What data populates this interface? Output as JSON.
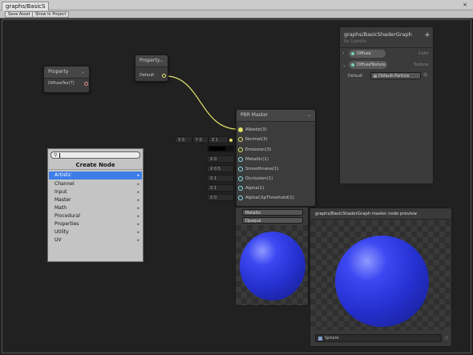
{
  "window": {
    "tab_title": "graphs/BasicS",
    "close_glyph": "×"
  },
  "toolbar": {
    "save_asset": "Save Asset",
    "show_in_project": "Show In Project"
  },
  "properties_node": {
    "title": "Property",
    "chevron": "⌄",
    "output_label": "DiffuseTex(T)"
  },
  "property_node": {
    "title": "Property",
    "chevron": "⌄",
    "output_label": "Default"
  },
  "master_node": {
    "title": "PBR Master",
    "chevron": "⌄",
    "slots": [
      {
        "label": "Albedo(3)",
        "port_color": "#e0e06a"
      },
      {
        "label": "Normal(3)",
        "port_color": "#e0e06a"
      },
      {
        "label": "Emission(3)",
        "port_color": "#e0e06a"
      },
      {
        "label": "Metallic(1)",
        "port_color": "#84e4e7"
      },
      {
        "label": "Smoothness(1)",
        "port_color": "#84e4e7"
      },
      {
        "label": "Occlusion(1)",
        "port_color": "#84e4e7"
      },
      {
        "label": "Alpha(1)",
        "port_color": "#84e4e7"
      },
      {
        "label": "AlphaClipThreshold(1)",
        "port_color": "#84e4e7"
      }
    ],
    "normal_inputs": [
      "X 0",
      "Y 0",
      "Z 1"
    ],
    "metallic_value": "X 0",
    "smoothness_value": "X 0.5",
    "occlusion_value": "X 1",
    "alpha_value": "X 1",
    "alpha_clip_value": "X 0",
    "emission_swatch": "#000000",
    "dropdowns": [
      "Metallic",
      "Opaque"
    ]
  },
  "create_node": {
    "title": "Create Node",
    "search_placeholder": "",
    "items": [
      {
        "label": "Artistic",
        "selected": true
      },
      {
        "label": "Channel",
        "selected": false
      },
      {
        "label": "Input",
        "selected": false
      },
      {
        "label": "Master",
        "selected": false
      },
      {
        "label": "Math",
        "selected": false
      },
      {
        "label": "Procedural",
        "selected": false
      },
      {
        "label": "Properties",
        "selected": false
      },
      {
        "label": "Utility",
        "selected": false
      },
      {
        "label": "UV",
        "selected": false
      }
    ],
    "submenu_glyph": "▸"
  },
  "blackboard": {
    "title": "graphs/BasicShaderGraph",
    "subtitle": "No Subtitle",
    "add_glyph": "+",
    "properties": [
      {
        "name": "Diffuse",
        "type": "Color",
        "expanded": false
      },
      {
        "name": "DiffuseTexture",
        "type": "Texture",
        "expanded": true
      }
    ],
    "default_label": "Default",
    "default_value": "Default-Particle"
  },
  "preview": {
    "title": "graphs/BasicShaderGraph master node preview",
    "mesh_label": "Sphere"
  },
  "colors": {
    "sphere": "#2f3ae0",
    "accent_selected": "#3d7de9",
    "vector_port": "#e0e06a",
    "float_port": "#84e4e7"
  }
}
